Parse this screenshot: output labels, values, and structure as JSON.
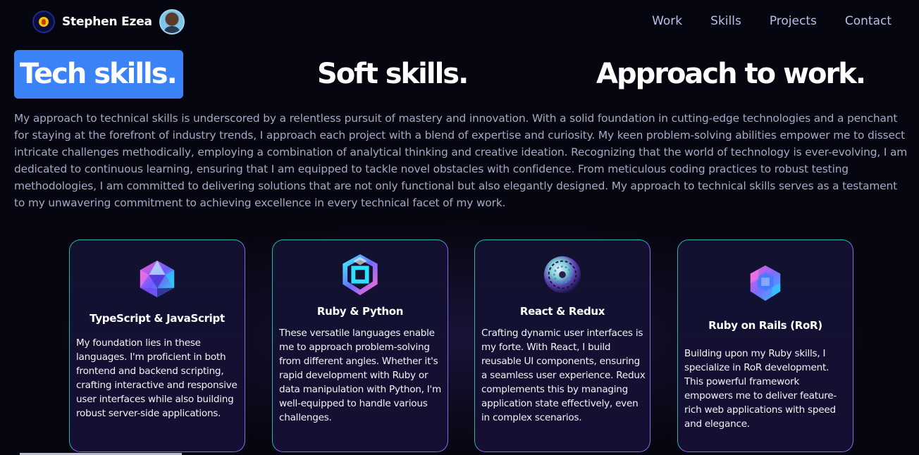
{
  "header": {
    "brand_name": "Stephen Ezea",
    "nav": [
      "Work",
      "Skills",
      "Projects",
      "Contact"
    ]
  },
  "tabs": [
    "Tech skills.",
    "Soft skills.",
    "Approach to work."
  ],
  "active_tab": "Tech skills.",
  "intro": "My approach to technical skills is underscored by a relentless pursuit of mastery and innovation. With a solid foundation in cutting-edge technologies and a penchant for staying at the forefront of industry trends, I approach each project with a blend of expertise and curiosity. My keen problem-solving abilities empower me to dissect intricate challenges methodically, employing a combination of analytical thinking and creative ideation. Recognizing that the world of technology is ever-evolving, I am dedicated to continuous learning, ensuring that I am equipped to tackle novel obstacles with confidence. From meticulous coding practices to robust testing methodologies, I am committed to delivering solutions that are not only functional but also elegantly designed. My approach to technical skills serves as a testament to my unwavering commitment to achieving excellence in every technical facet of my work.",
  "cards": [
    {
      "title": "TypeScript & JavaScript",
      "icon": "icosahedron-icon",
      "desc": "My foundation lies in these languages. I'm proficient in both frontend and backend scripting, crafting interactive and responsive user interfaces while also building robust server-side applications."
    },
    {
      "title": "Ruby & Python",
      "icon": "cube-knot-icon",
      "desc": "These versatile languages enable me to approach problem-solving from different angles. Whether it's rapid development with Ruby or data manipulation with Python, I'm well-equipped to handle various challenges."
    },
    {
      "title": "React & Redux",
      "icon": "sphere-icon",
      "desc": "Crafting dynamic user interfaces is my forte. With React, I build reusable UI components, ensuring a seamless user experience. Redux complements this by managing application state effectively, even in complex scenarios."
    },
    {
      "title": "Ruby on Rails (RoR)",
      "icon": "hex-cluster-icon",
      "desc": "Building upon my Ruby skills, I specialize in RoR development. This powerful framework empowers me to deliver feature-rich web applications with speed and elegance."
    }
  ],
  "colors": {
    "background": "#05060f",
    "active_tab": "#3b82f6",
    "nav_text": "#b9c0e8",
    "intro_text": "#a7a9c6",
    "card_border_top": "#2fb3a8",
    "card_border_bottom": "#a259e6"
  }
}
